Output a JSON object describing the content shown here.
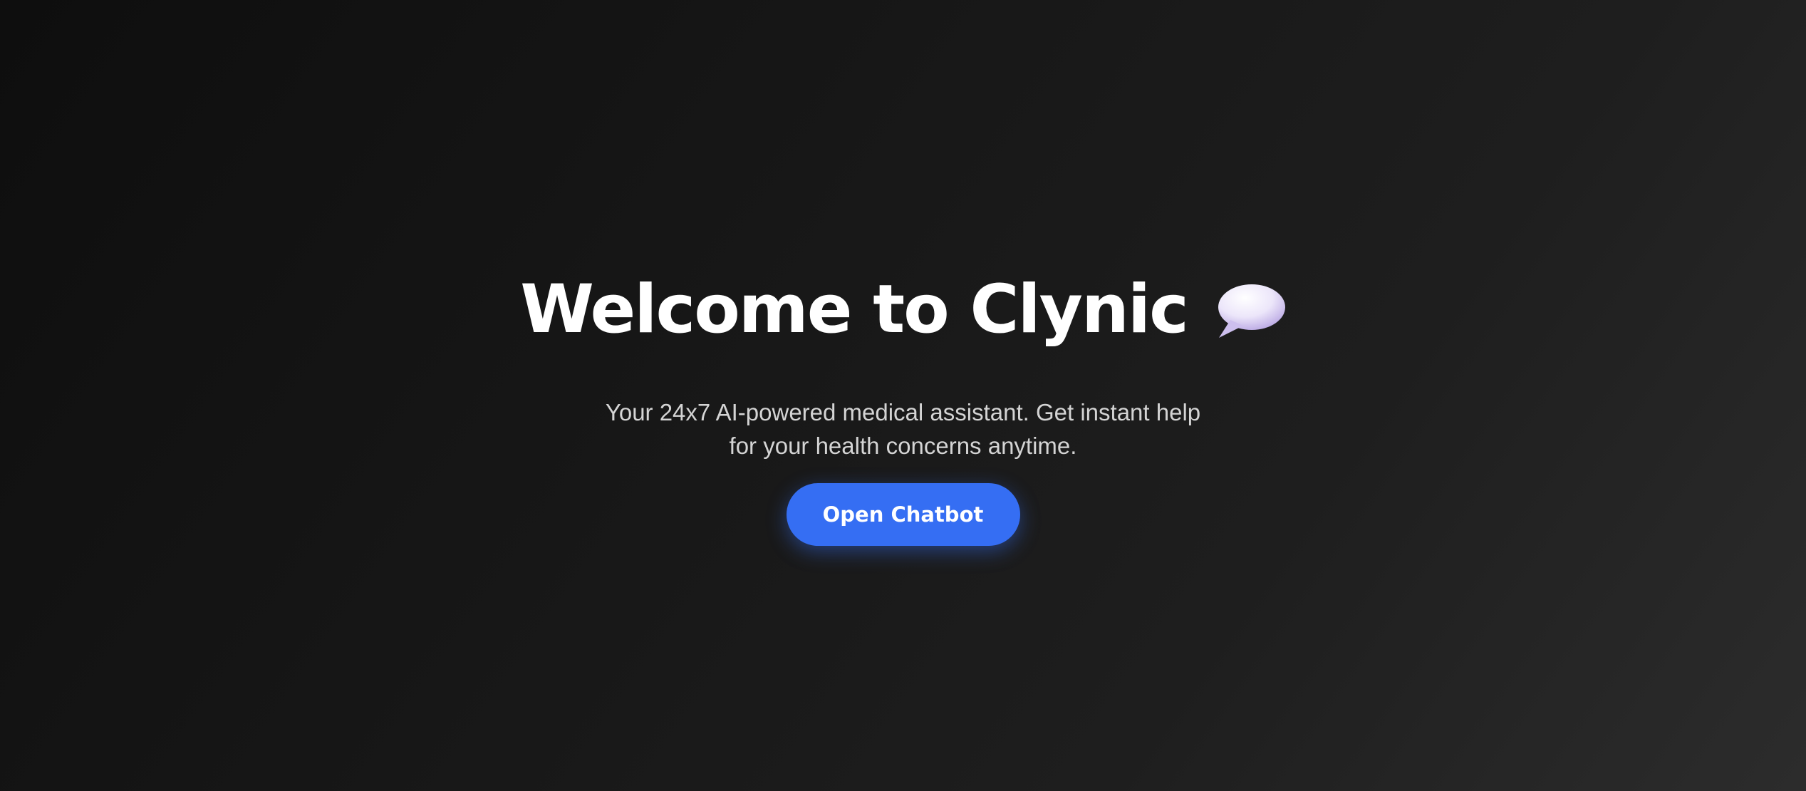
{
  "hero": {
    "title": "Welcome to Clynic",
    "title_icon": "speech-bubble-icon",
    "subtitle_line1": "Your 24x7 AI-powered medical assistant. Get instant help",
    "subtitle_line2": "for your health concerns anytime.",
    "cta_label": "Open Chatbot"
  },
  "colors": {
    "background": "#141414",
    "title": "#ffffff",
    "subtitle": "#d4d4d4",
    "accent": "#356ef3",
    "bubble": "#e4dcf6"
  }
}
